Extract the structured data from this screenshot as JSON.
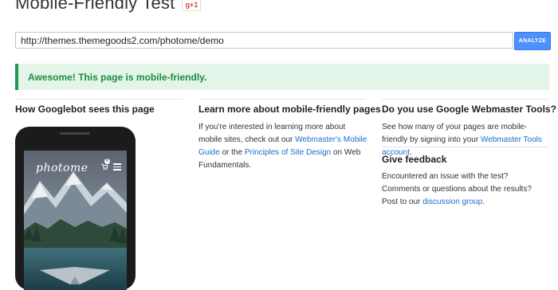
{
  "header": {
    "title": "Mobile-Friendly Test",
    "gplus_label": "g+1"
  },
  "form": {
    "url_value": "http://themes.themegoods2.com/photome/demo",
    "analyze_label": "ANALYZE"
  },
  "result": {
    "message": "Awesome! This page is mobile-friendly."
  },
  "left_column": {
    "title": "How Googlebot sees this page",
    "preview": {
      "site_logo": "photome",
      "cart_count": "0",
      "icons": [
        "cart-icon",
        "menu-icon"
      ]
    }
  },
  "middle_column": {
    "title": "Learn more about mobile-friendly pages",
    "text_1": "If you're interested in learning more about mobile sites, check out our ",
    "link_1": "Webmaster's Mobile Guide",
    "text_2": " or the ",
    "link_2": "Principles of Site Design",
    "text_3": " on Web Fundamentals."
  },
  "right_column": {
    "webmaster": {
      "title": "Do you use Google Webmaster Tools?",
      "text_1": "See how many of your pages are mobile-friendly by signing into your ",
      "link": "Webmaster Tools account",
      "text_2": "."
    },
    "feedback": {
      "title": "Give feedback",
      "text_1": "Encountered an issue with the test? Comments or questions about the results? Post to our ",
      "link": "discussion group",
      "text_2": "."
    }
  },
  "colors": {
    "accent_blue": "#4d90fe",
    "link_blue": "#1a6fc9",
    "success_green": "#1e8e3e",
    "banner_bg": "#e3f4e9"
  }
}
